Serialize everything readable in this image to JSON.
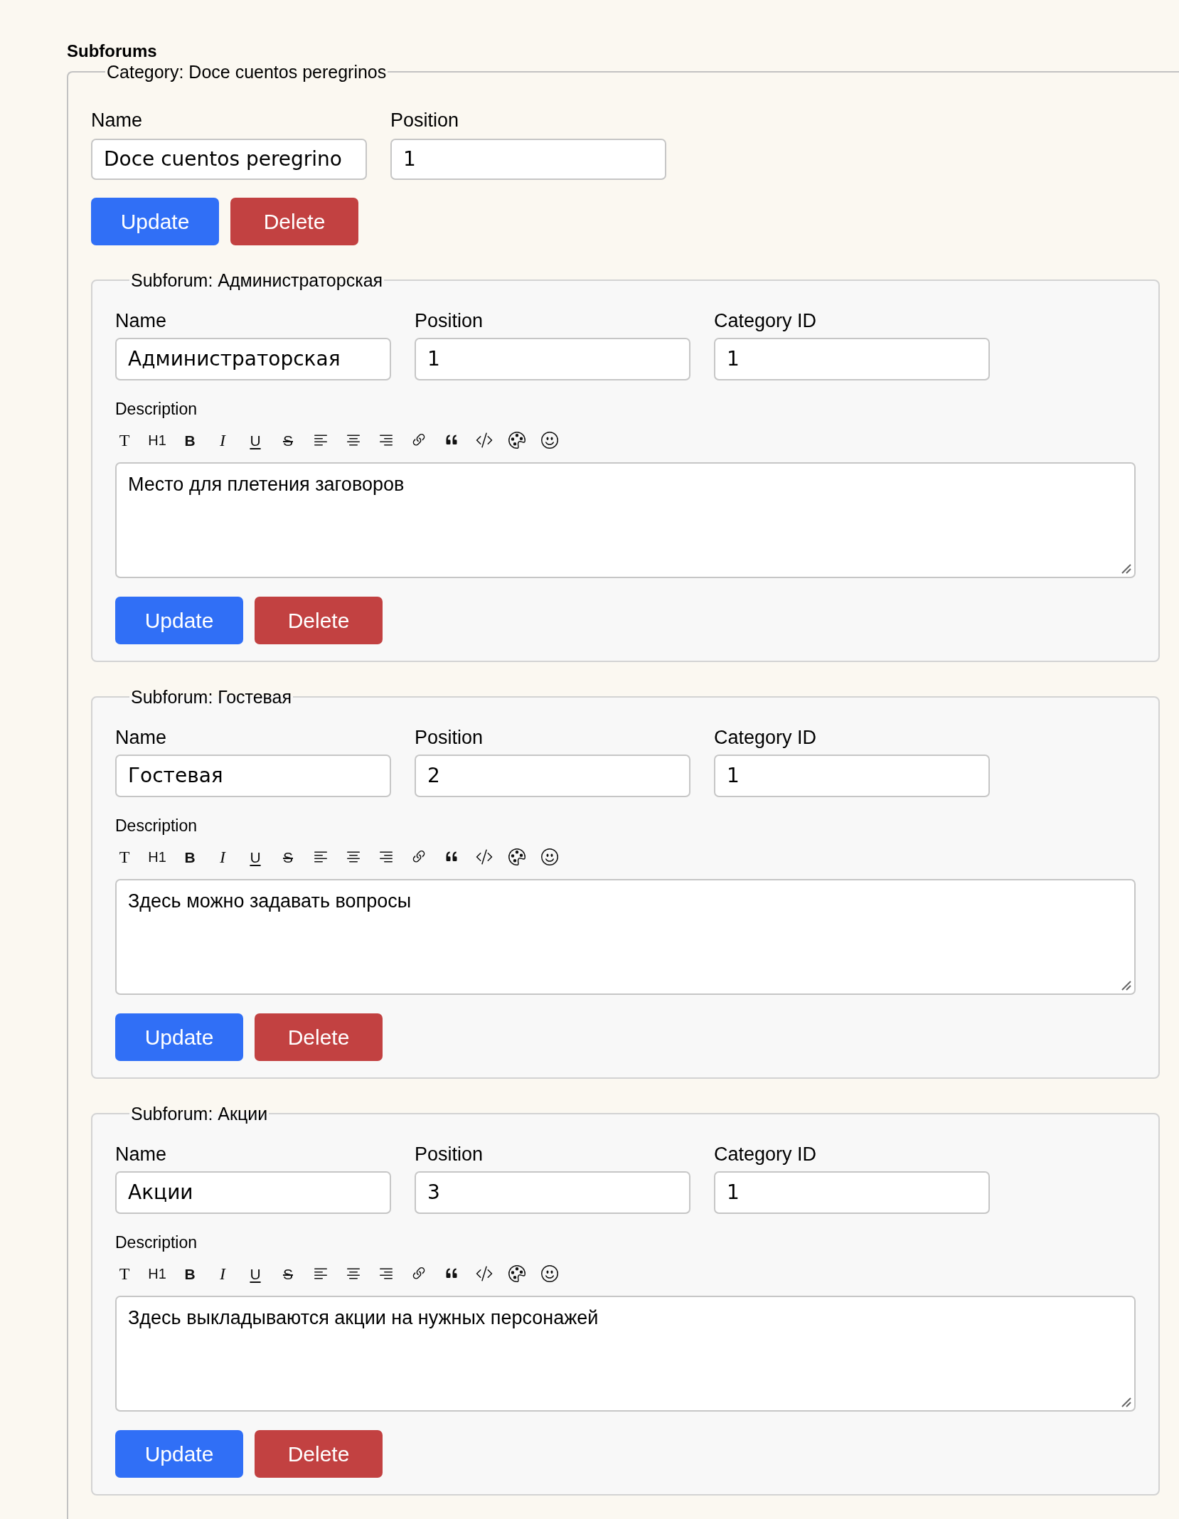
{
  "title": "Subforums",
  "category": {
    "legend": "Category: Doce cuentos peregrinos",
    "fields": [
      {
        "label": "Name",
        "value": "Doce cuentos peregrino"
      },
      {
        "label": "Position",
        "value": "1"
      }
    ],
    "buttons": [
      {
        "kind": "primary",
        "label": "Update"
      },
      {
        "kind": "danger",
        "label": "Delete"
      }
    ]
  },
  "subforums": [
    {
      "legend": "Subforum: Администраторская",
      "fields": [
        {
          "label": "Name",
          "value": "Администраторская"
        },
        {
          "label": "Position",
          "value": "1"
        },
        {
          "label": "Category ID",
          "value": "1"
        }
      ],
      "description": {
        "label": "Description",
        "toolbar": [
          "T",
          "H1",
          "B",
          "I",
          "U",
          "S"
        ],
        "value": "Место для плетения заговоров"
      },
      "buttons": [
        {
          "kind": "primary",
          "label": "Update"
        },
        {
          "kind": "danger",
          "label": "Delete"
        }
      ]
    },
    {
      "legend": "Subforum: Гостевая",
      "fields": [
        {
          "label": "Name",
          "value": "Гостевая"
        },
        {
          "label": "Position",
          "value": "2"
        },
        {
          "label": "Category ID",
          "value": "1"
        }
      ],
      "description": {
        "label": "Description",
        "toolbar": [
          "T",
          "H1",
          "B",
          "I",
          "U",
          "S"
        ],
        "value": "Здесь можно задавать вопросы"
      },
      "buttons": [
        {
          "kind": "primary",
          "label": "Update"
        },
        {
          "kind": "danger",
          "label": "Delete"
        }
      ]
    },
    {
      "legend": "Subforum: Акции",
      "fields": [
        {
          "label": "Name",
          "value": "Акции"
        },
        {
          "label": "Position",
          "value": "3"
        },
        {
          "label": "Category ID",
          "value": "1"
        }
      ],
      "description": {
        "label": "Description",
        "toolbar": [
          "T",
          "H1",
          "B",
          "I",
          "U",
          "S"
        ],
        "value": "Здесь выкладываются акции на нужных персонажей"
      },
      "buttons": [
        {
          "kind": "primary",
          "label": "Update"
        },
        {
          "kind": "danger",
          "label": "Delete"
        }
      ]
    }
  ]
}
